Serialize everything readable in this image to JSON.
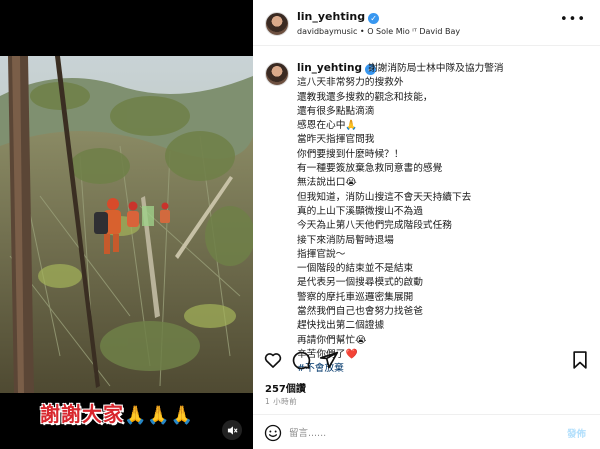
{
  "header": {
    "username": "lin_yehting",
    "audio": "davidbaymusic • O Sole Mio ᴵᵀ David Bay",
    "more": "•••"
  },
  "media": {
    "caption": "謝謝大家",
    "caption_emoji": "🙏🙏🙏",
    "colors": {
      "caption": "#d8262d"
    }
  },
  "post": {
    "username": "lin_yehting",
    "lines": [
      "謝謝消防局士林中隊及協力警消",
      "這八天非常努力的搜救外",
      "還教我還多搜救的觀念和技能，",
      "還有很多點點滴滴",
      "感恩在心中🙏",
      "當昨天指揮官問我",
      "你們要搜到什麼時候？！",
      "有一種要簽放棄急救同意書的感覺",
      "無法說出口😭",
      "但我知道，消防山搜這不會天天持續下去",
      "真的上山下溪顯微搜山不為過",
      "今天為止第八天他們完成階段式任務",
      "接下來消防局暫時退場",
      "指揮官說～",
      "一個階段的結束並不是結束",
      "是代表另一個搜尋模式的啟動",
      "警察的摩托車巡邏密集展開",
      "當然我們自己也會努力找爸爸",
      "趕快找出第二個證據",
      "再請你們幫忙😭",
      "辛苦你們了"
    ],
    "heart": "❤️",
    "hashtag": "#不會放棄"
  },
  "stats": {
    "likes": "257個讚",
    "time": "1 小時前"
  },
  "comment": {
    "placeholder": "留言......",
    "post_label": "發佈"
  },
  "icons": {
    "verified": "verified-badge-icon",
    "like": "heart-icon",
    "comment": "comment-icon",
    "share": "send-icon",
    "save": "bookmark-icon",
    "mute": "speaker-muted-icon",
    "emoji": "smiley-icon"
  },
  "colors": {
    "verified": "#3897f0",
    "hashtag": "#00376b",
    "post_button": "#b2dffc"
  }
}
